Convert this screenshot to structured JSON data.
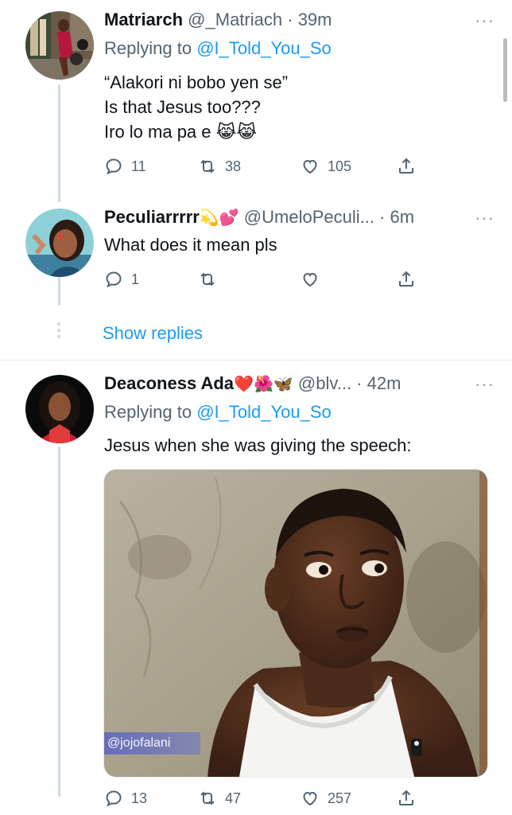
{
  "tweets": [
    {
      "name": "Matriarch",
      "handle": "@_Matriach",
      "sep": "·",
      "time": "39m",
      "more": "···",
      "reply_prefix": "Replying to",
      "reply_mention": "@I_Told_You_So",
      "lines": [
        "“Alakori ni bobo yen se”",
        "Is that Jesus too???",
        "Iro lo ma pa e 😹😹"
      ],
      "reply_count": "11",
      "retweet_count": "38",
      "like_count": "105"
    },
    {
      "name": "Peculiarrrrr",
      "name_emoji": "💫💕",
      "handle": "@UmeloPeculi...",
      "sep": "·",
      "time": "6m",
      "more": "···",
      "lines": [
        "What does it mean pls"
      ],
      "reply_count": "1",
      "retweet_count": "",
      "like_count": ""
    },
    {
      "name": "Deaconess Ada",
      "name_emoji": "❤️🌺🦋",
      "handle": "@blv...",
      "sep": "·",
      "time": "42m",
      "more": "···",
      "reply_prefix": "Replying to",
      "reply_mention": "@I_Told_You_So",
      "lines": [
        "Jesus when she was giving the speech:"
      ],
      "media_watermark": "@jojofalani",
      "reply_count": "13",
      "retweet_count": "47",
      "like_count": "257"
    }
  ],
  "show_replies": "Show replies",
  "colors": {
    "accent": "#1d9bf0",
    "secondary_text": "#536471",
    "thread_line": "#cfd9de"
  }
}
